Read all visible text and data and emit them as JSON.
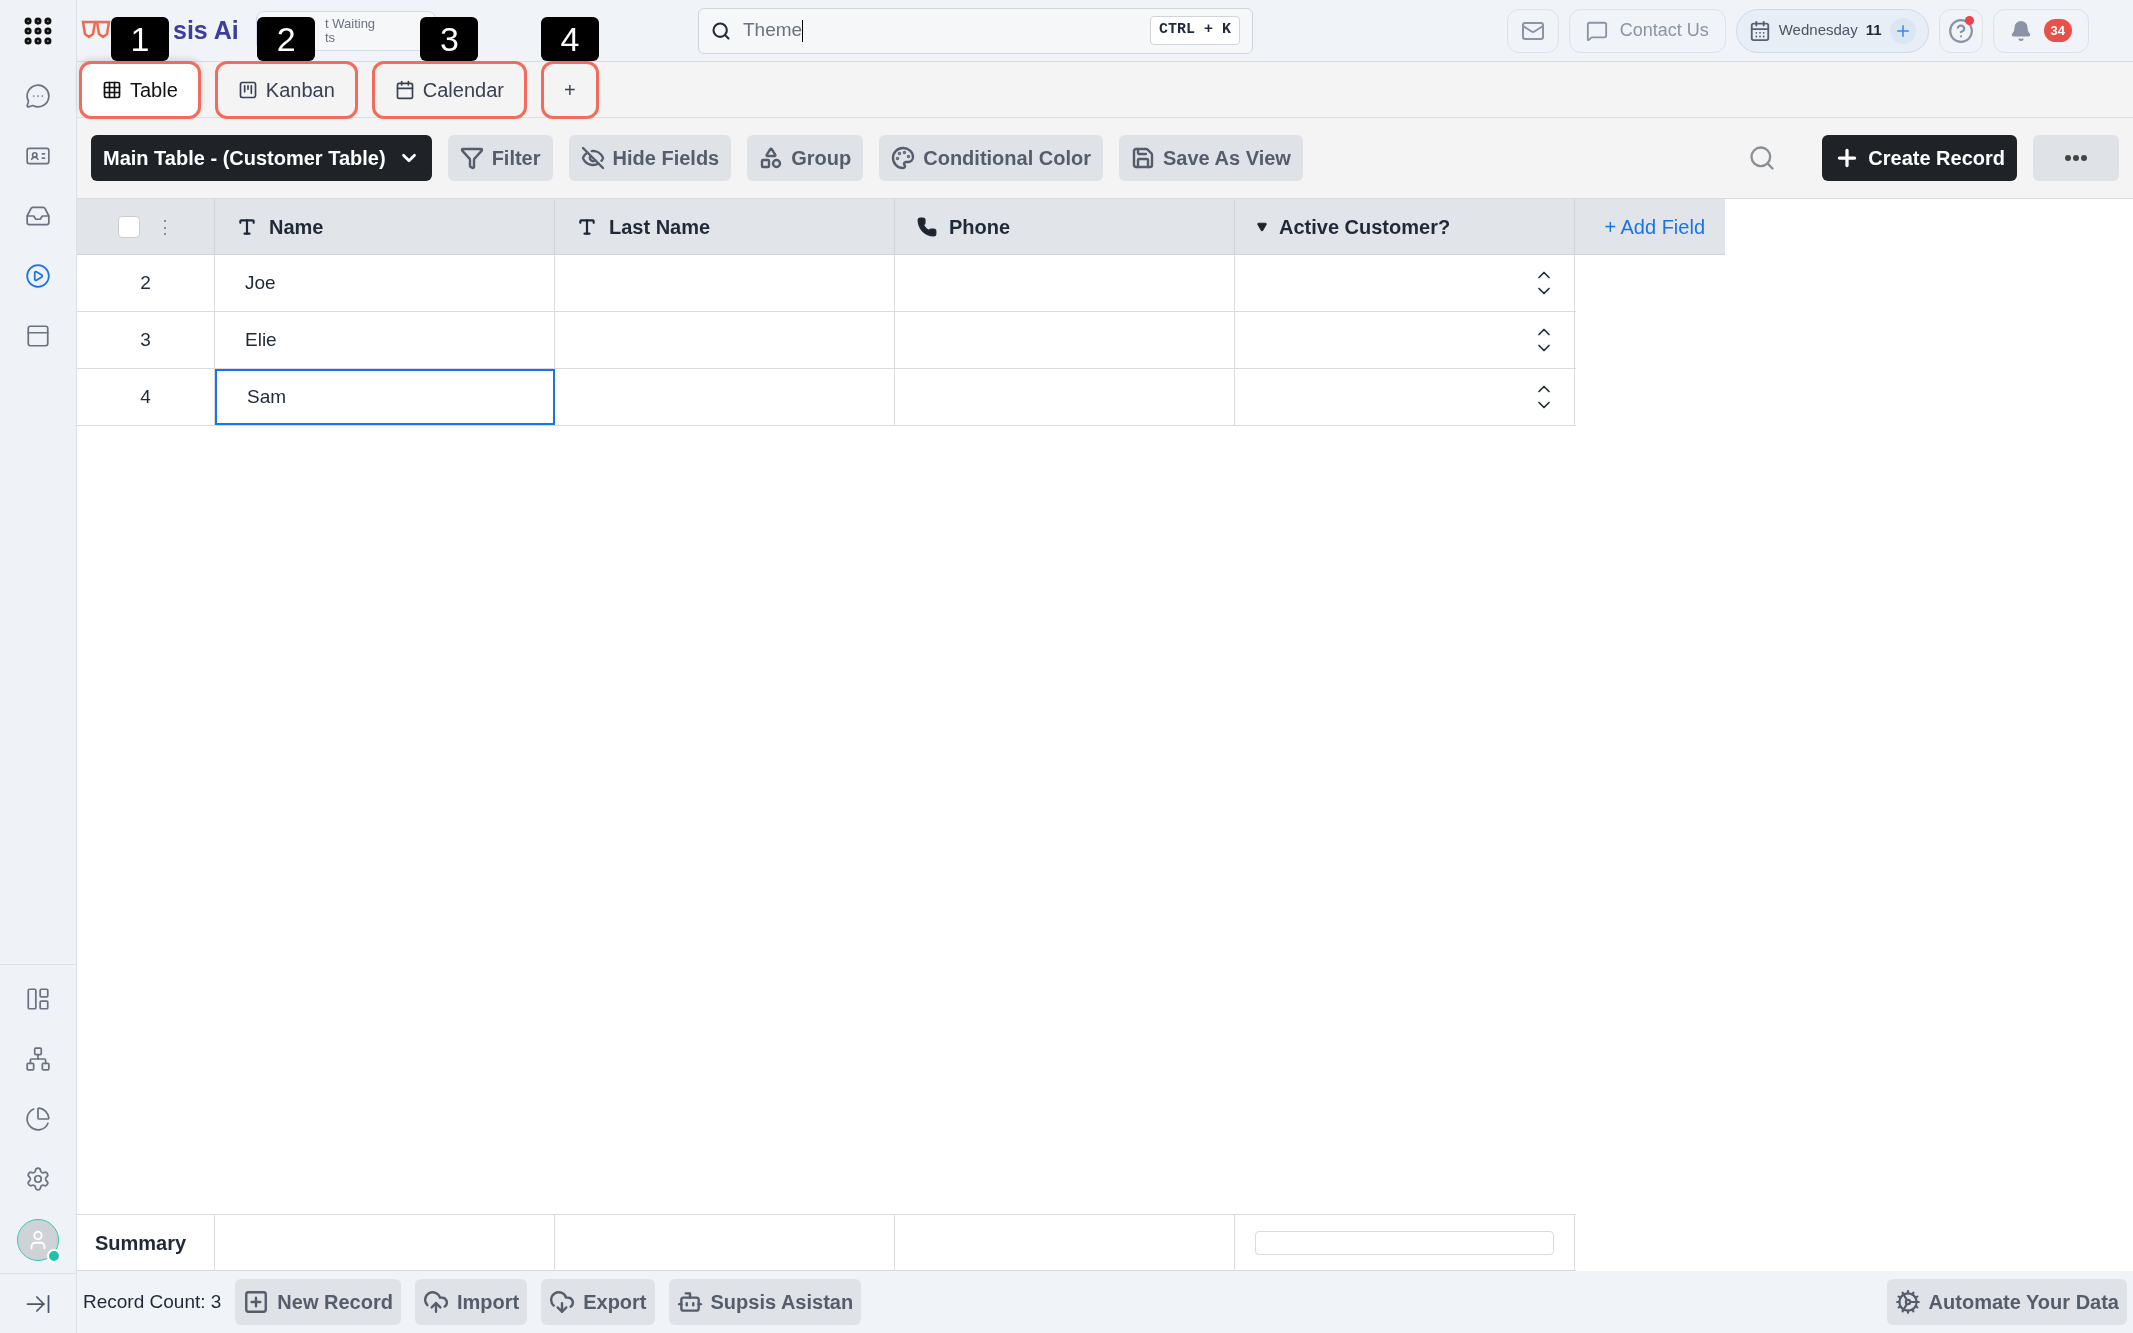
{
  "logo": {
    "text": "sis Ai"
  },
  "notice": {
    "lines": [
      "t Waiting",
      "ts"
    ]
  },
  "search": {
    "value": "Theme",
    "shortcut": "CTRL + K"
  },
  "header": {
    "contact": "Contact Us",
    "day": "Wednesday",
    "date": "11",
    "help_alert": true,
    "notifications": "34"
  },
  "sidebar": {
    "top_items": [
      {
        "kind": "chat",
        "selected": false
      },
      {
        "kind": "contact",
        "selected": false
      },
      {
        "kind": "inbox",
        "selected": false
      },
      {
        "kind": "play",
        "selected": true
      },
      {
        "kind": "panel",
        "selected": false
      }
    ],
    "bottom_items": [
      {
        "kind": "layout",
        "selected": false
      },
      {
        "kind": "hierarchy",
        "selected": false
      },
      {
        "kind": "pie",
        "selected": false
      },
      {
        "kind": "settings",
        "selected": false
      }
    ],
    "user_online": true
  },
  "view_tabs": [
    {
      "label": "Table",
      "kind": "table",
      "selected": true,
      "callout": "1"
    },
    {
      "label": "Kanban",
      "kind": "kanban",
      "selected": false,
      "callout": "2"
    },
    {
      "label": "Calendar",
      "kind": "calendar",
      "selected": false,
      "callout": "3"
    },
    {
      "label": "+",
      "kind": "add",
      "callout": "4"
    }
  ],
  "toolbar": {
    "table_selector": "Main Table - (Customer Table)",
    "buttons": [
      {
        "kind": "filter",
        "label": "Filter"
      },
      {
        "kind": "hide",
        "label": "Hide Fields"
      },
      {
        "kind": "group",
        "label": "Group"
      },
      {
        "kind": "color",
        "label": "Conditional Color"
      },
      {
        "kind": "save",
        "label": "Save As View"
      }
    ],
    "create": "Create Record"
  },
  "table": {
    "select_all": {
      "checked": false
    },
    "column_menu": "⋮",
    "columns": [
      {
        "kind": "text",
        "label": "Name"
      },
      {
        "kind": "text",
        "label": "Last Name"
      },
      {
        "kind": "phone",
        "label": "Phone"
      },
      {
        "kind": "dropdown",
        "label": "Active Customer?"
      }
    ],
    "add_field": "+ Add Field",
    "rows": [
      {
        "number": "2",
        "name": "Joe",
        "selected": false
      },
      {
        "number": "3",
        "name": "Elie",
        "selected": false
      },
      {
        "number": "4",
        "name": "Sam",
        "selected": true
      }
    ],
    "summary_label": "Summary"
  },
  "footer": {
    "record_count": "Record Count: 3",
    "buttons": [
      {
        "kind": "new",
        "label": "New Record"
      },
      {
        "kind": "import",
        "label": "Import"
      },
      {
        "kind": "export",
        "label": "Export"
      },
      {
        "kind": "assistant",
        "label": "Supsis Asistan"
      }
    ],
    "automate": "Automate Your Data"
  }
}
